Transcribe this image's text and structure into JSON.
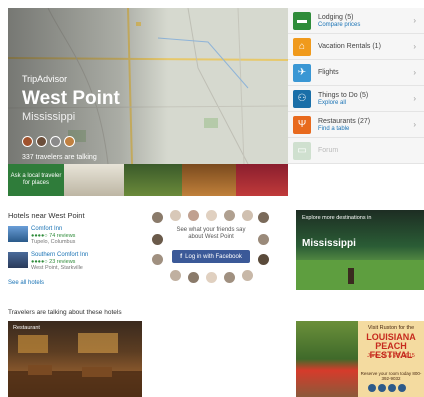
{
  "hero": {
    "brand": "TripAdvisor",
    "city": "West Point",
    "state": "Mississippi",
    "travelers": "337 travelers are talking",
    "photo_strip_label": "Ask a local traveler for places"
  },
  "menu": [
    {
      "label": "Lodging (5)",
      "sub": "Compare prices",
      "icon": "bed-icon",
      "color": "#2f8c3a",
      "glyph": "▬",
      "dim": false
    },
    {
      "label": "Vacation Rentals (1)",
      "sub": "",
      "icon": "house-icon",
      "color": "#f09a1c",
      "glyph": "⌂",
      "dim": false
    },
    {
      "label": "Flights",
      "sub": "",
      "icon": "plane-icon",
      "color": "#3a97d4",
      "glyph": "✈",
      "dim": false
    },
    {
      "label": "Things to Do (5)",
      "sub": "Explore all",
      "icon": "binoculars-icon",
      "color": "#1a6fa8",
      "glyph": "⚇",
      "dim": false
    },
    {
      "label": "Restaurants (27)",
      "sub": "Find a table",
      "icon": "fork-knife-icon",
      "color": "#e86a1e",
      "glyph": "Ψ",
      "dim": false
    },
    {
      "label": "Forum",
      "sub": "",
      "icon": "forum-icon",
      "color": "#cfe0cf",
      "glyph": "▭",
      "dim": true
    }
  ],
  "hotels": {
    "heading": "Hotels near West Point",
    "items": [
      {
        "name": "Comfort Inn",
        "rating": "●●●●○ 74 reviews",
        "location": "Tupelo, Columbus"
      },
      {
        "name": "Southern Comfort Inn",
        "rating": "●●●●○ 23 reviews",
        "location": "West Point, Starkville"
      }
    ],
    "see_all": "See all hotels"
  },
  "facebook": {
    "message": "See what your friends say about West Point",
    "button": "Log in with Facebook"
  },
  "ad1": {
    "top_text": "Explore more destinations in",
    "word": "Mississippi"
  },
  "talking": {
    "heading": "Travelers are talking about these hotels",
    "photo_caption": "Restaurant"
  },
  "ad2": {
    "line1": "Visit Ruston for the",
    "line2": "LOUISIANA PEACH FESTIVAL",
    "line3": "June 26 & 27, 2015",
    "line4": "Reserve your room today 800-392-9032"
  }
}
